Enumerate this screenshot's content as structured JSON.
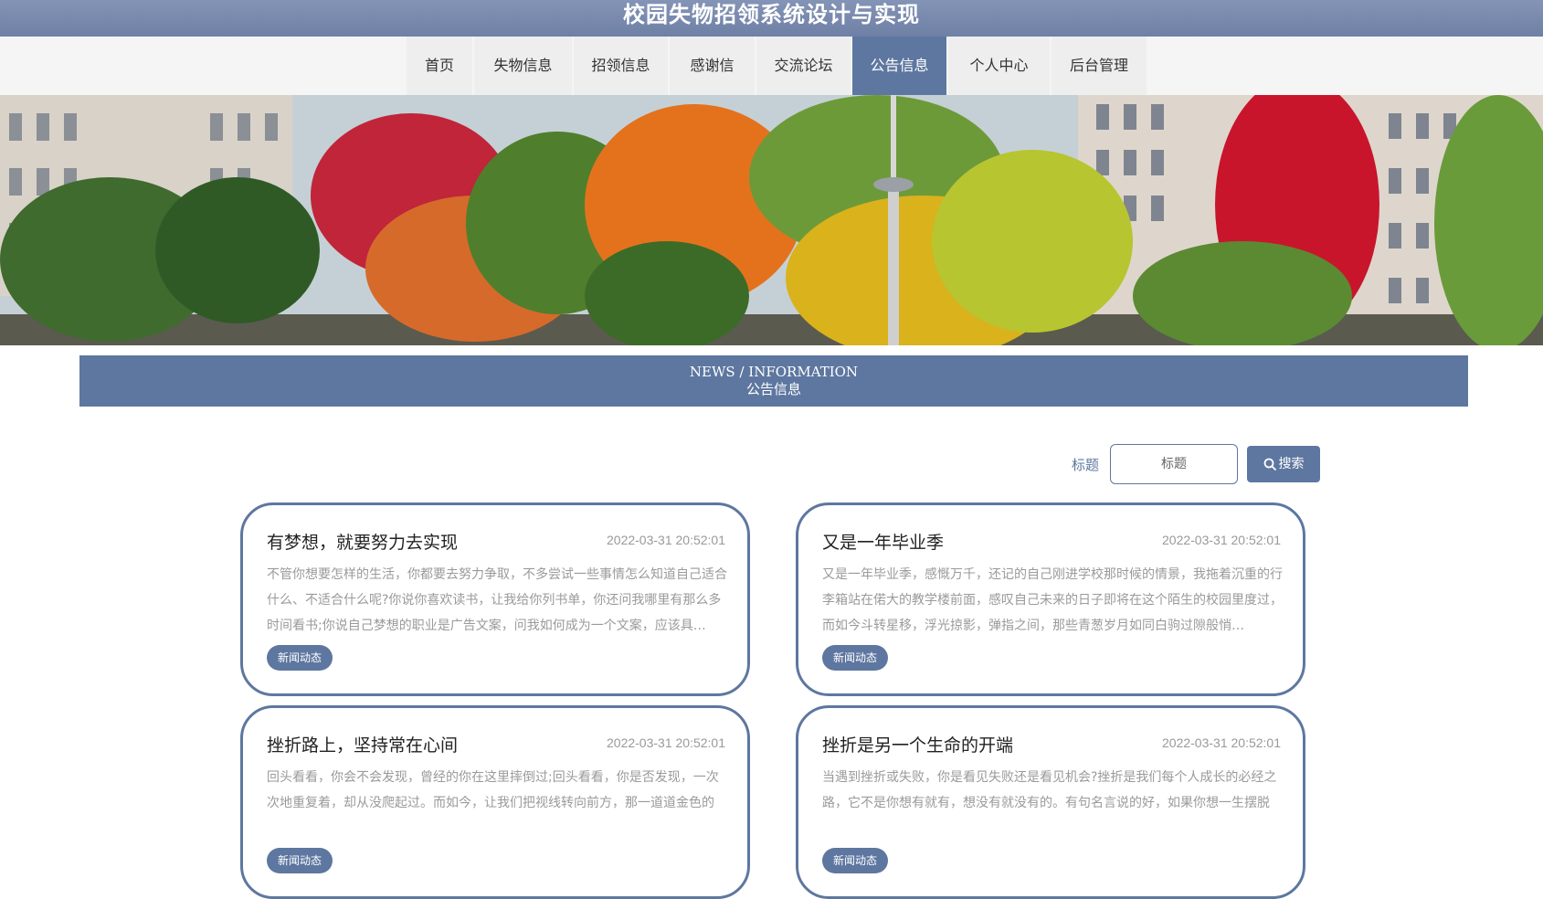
{
  "header": {
    "title": "校园失物招领系统设计与实现"
  },
  "nav": {
    "items": [
      {
        "label": "首页"
      },
      {
        "label": "失物信息"
      },
      {
        "label": "招领信息"
      },
      {
        "label": "感谢信"
      },
      {
        "label": "交流论坛"
      },
      {
        "label": "公告信息"
      },
      {
        "label": "个人中心"
      },
      {
        "label": "后台管理"
      }
    ],
    "active": "公告信息"
  },
  "section": {
    "title_en": "NEWS / INFORMATION",
    "title_cn": "公告信息"
  },
  "search": {
    "label": "标题",
    "placeholder": "标题",
    "button": "搜索"
  },
  "colors": {
    "accent": "#5e77a0",
    "header": "#7b8bb0"
  },
  "cards": [
    {
      "title": "有梦想，就要努力去实现",
      "date": "2022-03-31 20:52:01",
      "body": "不管你想要怎样的生活，你都要去努力争取，不多尝试一些事情怎么知道自己适合什么、不适合什么呢?你说你喜欢读书，让我给你列书单，你还问我哪里有那么多时间看书;你说自己梦想的职业是广告文案，问我如何成为一个文案，应该具…",
      "tag": "新闻动态"
    },
    {
      "title": "又是一年毕业季",
      "date": "2022-03-31 20:52:01",
      "body": "又是一年毕业季，感慨万千，还记的自己刚进学校那时候的情景，我拖着沉重的行李箱站在偌大的教学楼前面，感叹自己未来的日子即将在这个陌生的校园里度过，而如今斗转星移，浮光掠影，弹指之间，那些青葱岁月如同白驹过隙般悄…",
      "tag": "新闻动态"
    },
    {
      "title": "挫折路上，坚持常在心间",
      "date": "2022-03-31 20:52:01",
      "body": "回头看看，你会不会发现，曾经的你在这里摔倒过;回头看看，你是否发现，一次次地重复着，却从没爬起过。而如今，让我们把视线转向前方，那一道道金色的",
      "tag": "新闻动态"
    },
    {
      "title": "挫折是另一个生命的开端",
      "date": "2022-03-31 20:52:01",
      "body": "当遇到挫折或失败，你是看见失败还是看见机会?挫折是我们每个人成长的必经之路，它不是你想有就有，想没有就没有的。有句名言说的好，如果你想一生摆脱",
      "tag": "新闻动态"
    }
  ]
}
